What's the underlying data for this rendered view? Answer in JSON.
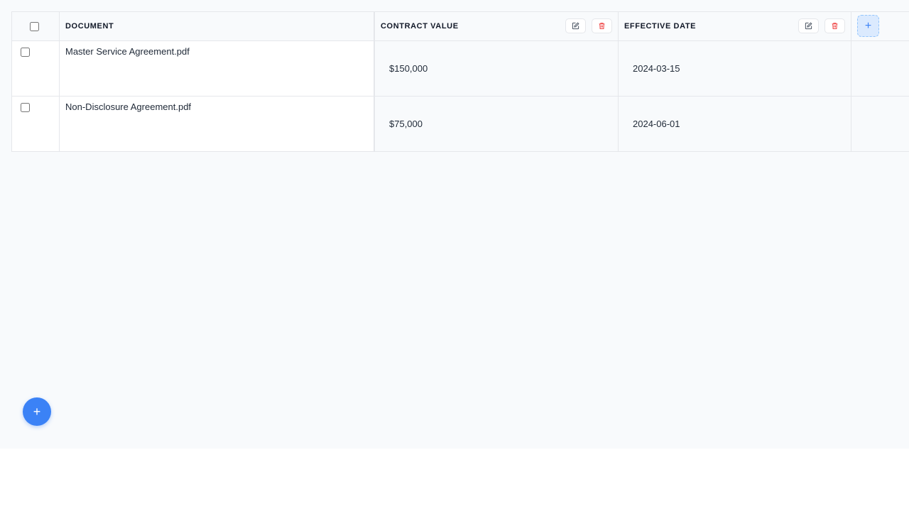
{
  "table": {
    "columns": [
      {
        "label": "DOCUMENT"
      },
      {
        "label": "CONTRACT VALUE",
        "edit_icon": "edit-icon",
        "delete_icon": "trash-icon"
      },
      {
        "label": "EFFECTIVE DATE",
        "edit_icon": "edit-icon",
        "delete_icon": "trash-icon"
      }
    ],
    "add_column_label": "+",
    "rows": [
      {
        "document": "Master Service Agreement.pdf",
        "contract_value": "$150,000",
        "effective_date": "2024-03-15"
      },
      {
        "document": "Non-Disclosure Agreement.pdf",
        "contract_value": "$75,000",
        "effective_date": "2024-06-01"
      }
    ]
  },
  "fab": {
    "label": "+",
    "icon": "plus-icon"
  },
  "colors": {
    "accent": "#3b82f6",
    "delete": "#ef4444",
    "border": "#e5e7eb",
    "background": "#f8fafc"
  }
}
